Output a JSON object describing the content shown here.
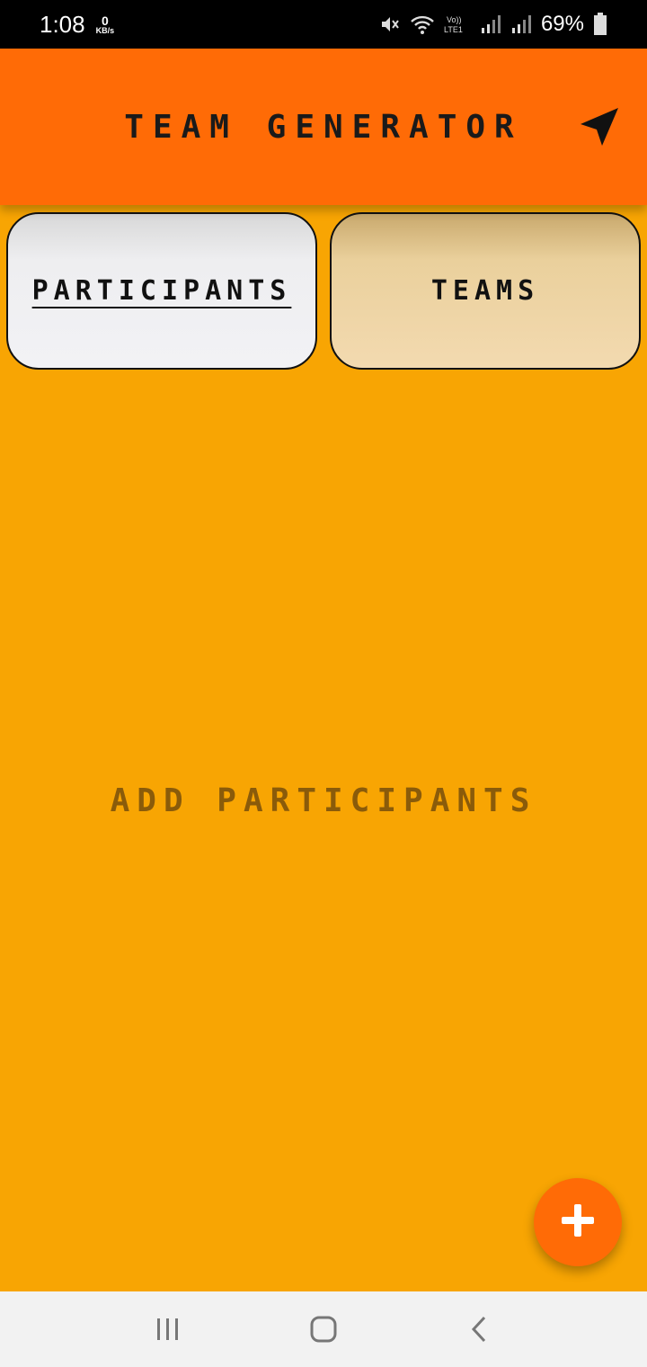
{
  "status_bar": {
    "time": "1:08",
    "speed_value": "0",
    "speed_unit": "KB/s",
    "battery_percent": "69%",
    "icons": [
      "mute-icon",
      "wifi-icon",
      "volte-icon",
      "signal-icon",
      "signal-icon",
      "battery-icon"
    ]
  },
  "app_bar": {
    "title": "Team Generator",
    "action_icon": "navigation-arrow-icon"
  },
  "tabs": [
    {
      "label": "Participants",
      "active": true
    },
    {
      "label": "Teams",
      "active": false
    }
  ],
  "main": {
    "empty_message": "Add Participants"
  },
  "fab": {
    "icon": "plus-icon"
  },
  "system_nav": {
    "icons": [
      "recent-apps-icon",
      "home-icon",
      "back-icon"
    ]
  },
  "colors": {
    "app_bar": "#FF6B06",
    "background": "#F8A503",
    "fab": "#FF6B06"
  }
}
